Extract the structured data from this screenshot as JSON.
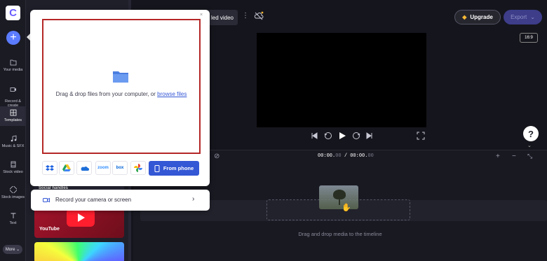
{
  "app": {
    "logo": "C"
  },
  "rail": {
    "items": [
      {
        "label": "Your media",
        "icon": "folder-icon"
      },
      {
        "label": "Record &\ncreate",
        "icon": "record-icon"
      },
      {
        "label": "Templates",
        "icon": "templates-icon"
      },
      {
        "label": "Music & SFX",
        "icon": "music-icon"
      },
      {
        "label": "Stock video",
        "icon": "film-icon"
      },
      {
        "label": "Stock images",
        "icon": "image-icon"
      },
      {
        "label": "Text",
        "icon": "text-icon"
      }
    ],
    "more_label": "More"
  },
  "panel": {
    "social_label": "Social handles",
    "youtube_label": "YouTube"
  },
  "topbar": {
    "title_fragment": "led video",
    "upgrade_label": "Upgrade",
    "export_label": "Export"
  },
  "preview": {
    "aspect_ratio": "16:9"
  },
  "timeline": {
    "time_current": "00:00.",
    "time_current_ms": "00",
    "time_sep": " / ",
    "time_total": "00:00.",
    "time_total_ms": "00",
    "hint": "Drag and drop media to the timeline"
  },
  "import_popup": {
    "drop_text": "Drag & drop files from your computer, or ",
    "browse_link": "browse files",
    "sources": [
      "dropbox",
      "google-drive",
      "onedrive",
      "zoom",
      "box",
      "google-photos"
    ],
    "zoom_label": "zoom",
    "box_label": "box",
    "phone_button": "From phone",
    "record_label": "Record your camera or screen"
  },
  "colors": {
    "accent": "#3457d5",
    "highlight_border": "#b52727",
    "rail_bg": "#1b1b24"
  }
}
